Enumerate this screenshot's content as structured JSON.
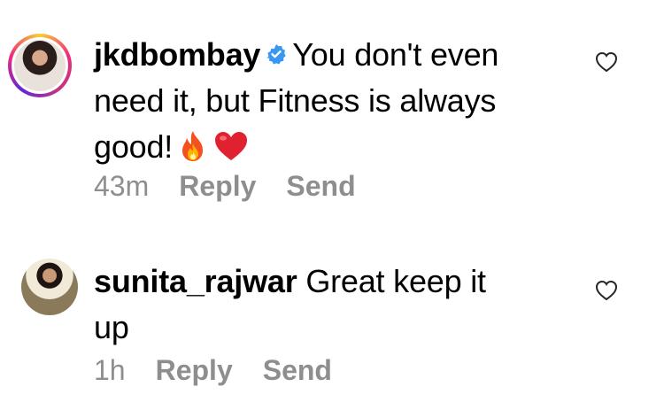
{
  "comments": [
    {
      "username": "jkdbombay",
      "verified": true,
      "text_parts": [
        "You don't even",
        "need it, but Fitness is always",
        "good!"
      ],
      "emojis": [
        "fire-icon",
        "red-heart-icon"
      ],
      "time": "43m",
      "reply_label": "Reply",
      "send_label": "Send",
      "avatar_icon": "avatar-photo",
      "like_icon": "heart-outline-icon"
    },
    {
      "username": "sunita_rajwar",
      "verified": false,
      "text_parts": [
        "Great keep it",
        "up"
      ],
      "time": "1h",
      "reply_label": "Reply",
      "send_label": "Send",
      "avatar_icon": "avatar-photo",
      "like_icon": "heart-outline-icon"
    }
  ],
  "colors": {
    "meta_text": "#8e8e8e",
    "verified_badge": "#3897f0",
    "story_ring": "#ee2a7b"
  }
}
